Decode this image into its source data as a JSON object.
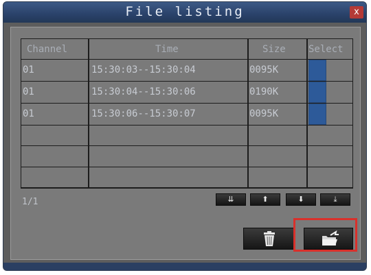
{
  "window": {
    "title": "File listing",
    "close_label": "x"
  },
  "table": {
    "headers": [
      "Channel",
      "Time",
      "Size",
      "Select"
    ],
    "rows": [
      {
        "channel": "01",
        "time": "15:30:03--15:30:04",
        "size": "0095K",
        "selected": true
      },
      {
        "channel": "01",
        "time": "15:30:04--15:30:06",
        "size": "0190K",
        "selected": true
      },
      {
        "channel": "01",
        "time": "15:30:06--15:30:07",
        "size": "0095K",
        "selected": true
      }
    ],
    "empty_rows": 3
  },
  "pagination": {
    "page_label": "1/1"
  },
  "nav_buttons": [
    {
      "name": "first-page-button",
      "icon": "double-arrow-down-icon",
      "glyph": "⇊"
    },
    {
      "name": "previous-page-button",
      "icon": "arrow-up-icon",
      "glyph": "⬆"
    },
    {
      "name": "next-page-button",
      "icon": "arrow-down-icon",
      "glyph": "⬇"
    },
    {
      "name": "last-page-button",
      "icon": "arrow-to-bottom-icon",
      "glyph": "⤓"
    }
  ],
  "actions": {
    "delete_icon": "trash-icon",
    "backup_icon": "folder-export-icon"
  },
  "colors": {
    "title_bar": "#2a426a",
    "select_fill": "#2d5a99",
    "highlight": "#d9302b"
  }
}
